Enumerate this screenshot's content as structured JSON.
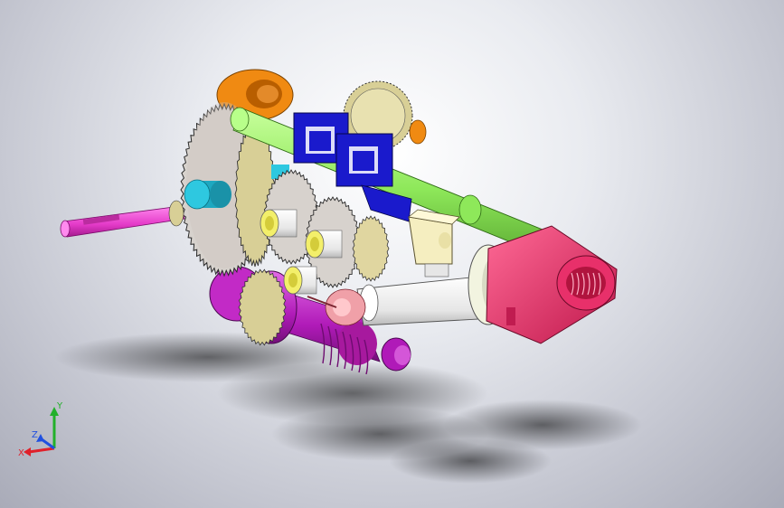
{
  "view": {
    "background_top": "#ffffff",
    "background_bottom": "#a9abb8"
  },
  "colors": {
    "shaft_green": "#9cf26a",
    "bracket_blue": "#1a1acc",
    "gear_gray": "#d7d2cd",
    "gear_olive": "#d8cf96",
    "orange_part": "#f08a12",
    "magenta_shaft": "#e83acb",
    "purple_worm": "#b01ab8",
    "pink_housing": "#e8306a",
    "cyan_hub": "#2ec8e0",
    "yellow_part": "#f3ef6a",
    "cream_block": "#f5eec0"
  },
  "triad": {
    "x_label": "X",
    "y_label": "Y",
    "z_label": "Z",
    "x_color": "#e0202a",
    "y_color": "#22b02a",
    "z_color": "#2050e0"
  }
}
